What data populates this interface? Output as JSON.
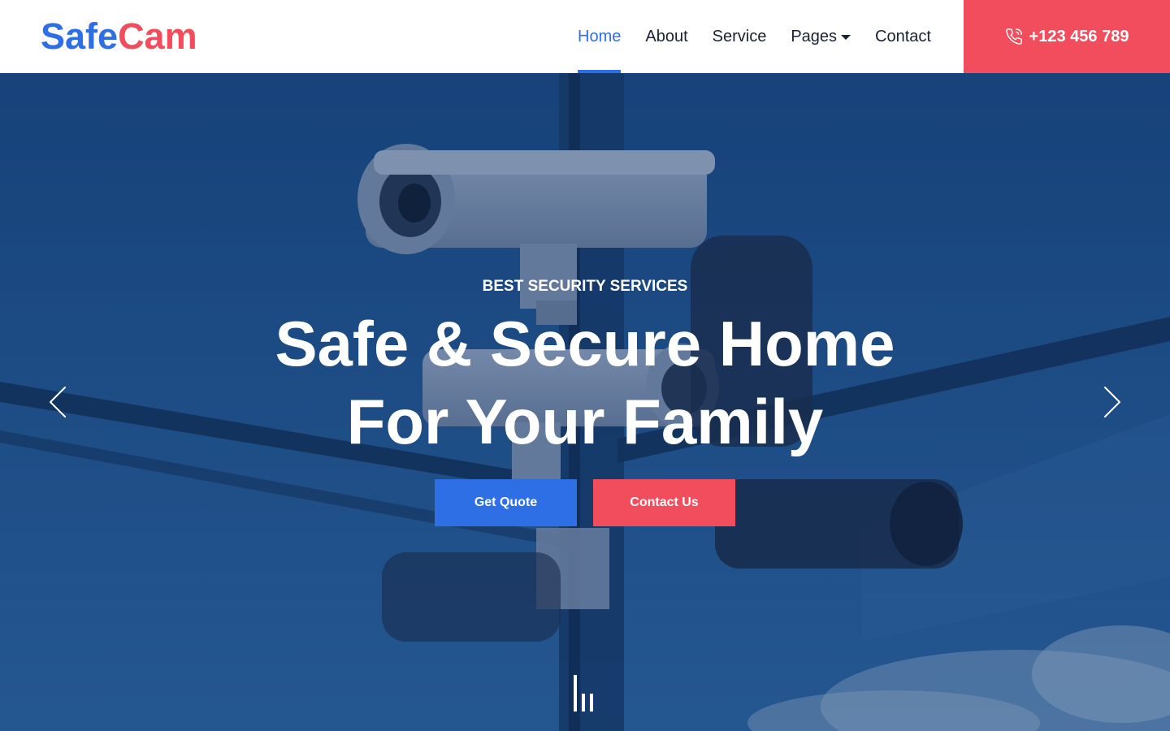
{
  "brand": {
    "part1": "Safe",
    "part2": "Cam",
    "colors": {
      "primary": "#2f6fe6",
      "accent": "#f14d5d"
    }
  },
  "nav": {
    "items": [
      {
        "label": "Home",
        "active": true
      },
      {
        "label": "About"
      },
      {
        "label": "Service"
      },
      {
        "label": "Pages",
        "dropdown": true
      },
      {
        "label": "Contact"
      }
    ]
  },
  "phone": {
    "icon": "phone-icon",
    "number": "+123 456 789"
  },
  "hero": {
    "eyebrow": "BEST SECURITY SERVICES",
    "title_line1": "Safe & Secure Home",
    "title_line2": "For Your Family",
    "primary_button": "Get Quote",
    "secondary_button": "Contact Us",
    "prev_icon": "chevron-left-icon",
    "next_icon": "chevron-right-icon",
    "slide_indicator_icon": "slide-bars-icon"
  }
}
